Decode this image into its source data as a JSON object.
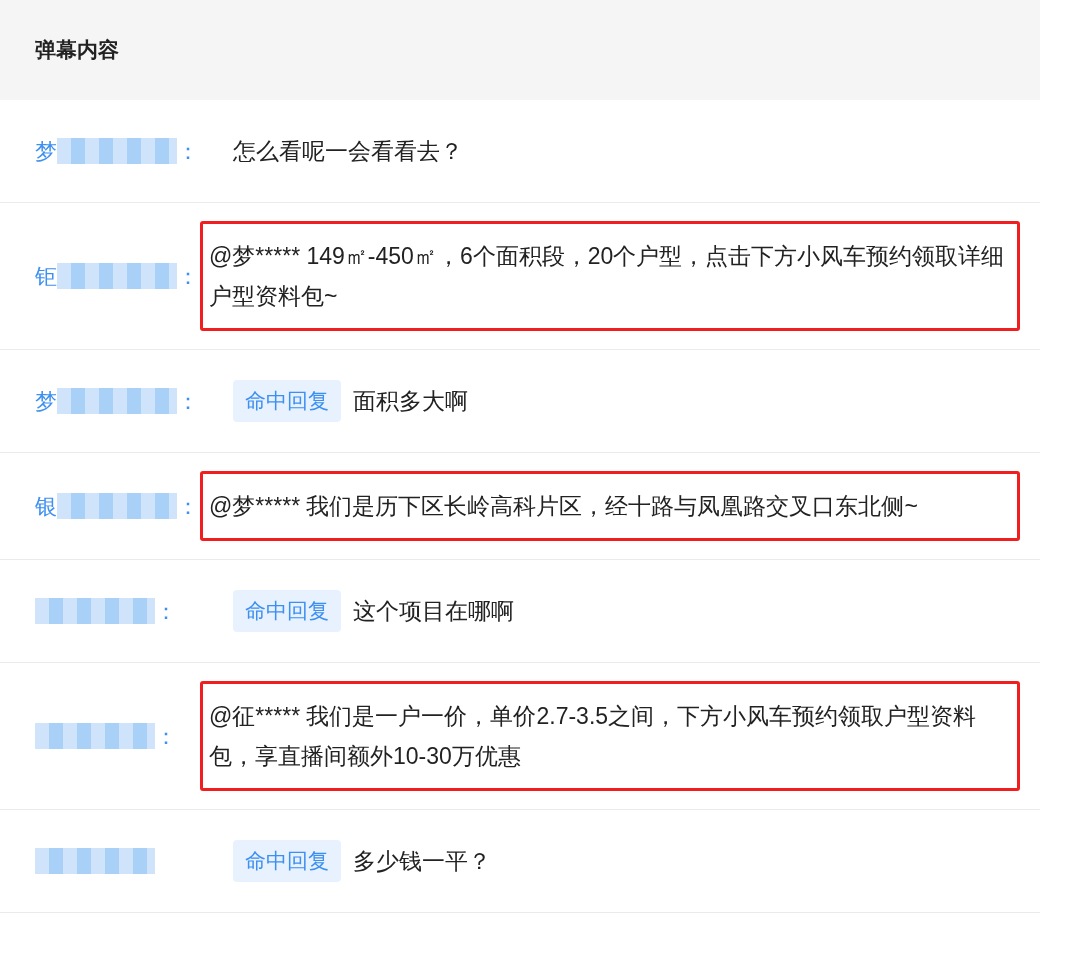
{
  "header": "弹幕内容",
  "rows": [
    {
      "name": "梦",
      "colon": "：",
      "content": "怎么看呢一会看看去？",
      "highlighted": false
    },
    {
      "name": "钜",
      "colon": "：",
      "content": "@梦***** 149㎡-450㎡，6个面积段，20个户型，点击下方小风车预约领取详细户型资料包~",
      "highlighted": true
    },
    {
      "name": "梦",
      "colon": "：",
      "tag": "命中回复",
      "content": "面积多大啊",
      "highlighted": false
    },
    {
      "name": "银",
      "colon": "：",
      "content": "@梦***** 我们是历下区长岭高科片区，经十路与凤凰路交叉口东北侧~",
      "highlighted": true
    },
    {
      "colon": "：",
      "tag": "命中回复",
      "content": "这个项目在哪啊",
      "highlighted": false
    },
    {
      "colon": "：",
      "content": "@征***** 我们是一户一价，单价2.7-3.5之间，下方小风车预约领取户型资料包，享直播间额外10-30万优惠",
      "highlighted": true
    },
    {
      "tag": "命中回复",
      "content": "多少钱一平？",
      "highlighted": false
    }
  ]
}
